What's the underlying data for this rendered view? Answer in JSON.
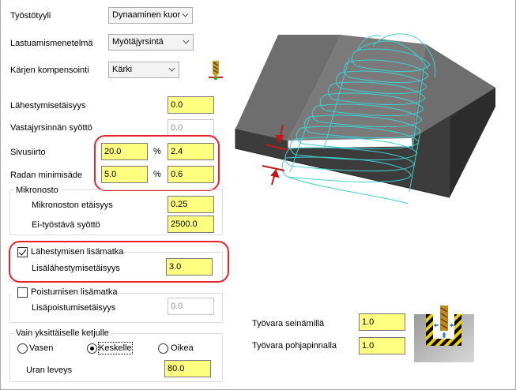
{
  "style_label": "Työstötyyli",
  "style_value": "Dynaaminen kuor",
  "method_label": "Lastuamismenetelmä",
  "method_value": "Myötäjyrsintä",
  "comp_label": "Kärjen kompensointi",
  "comp_value": "Kärki",
  "approach_dist_label": "Lähestymisetäisyys",
  "approach_dist_value": "0.0",
  "counter_feed_label": "Vastajyrsinnän syöttö",
  "counter_feed_value": "0.0",
  "stepover_label": "Sivusiirto",
  "stepover_pct": "20.0",
  "stepover_val": "2.4",
  "min_radius_label": "Radan minimisäde",
  "min_radius_pct": "5.0",
  "min_radius_val": "0.6",
  "percent_sign": "%",
  "micro": {
    "title": "Mikronosto",
    "dist_label": "Mikronoston etäisyys",
    "dist_value": "0.25",
    "feed_label": "Ei-työstävä syöttö",
    "feed_value": "2500.0"
  },
  "approach_extra": {
    "title": "Lähestymisen lisämatka",
    "checked": true,
    "dist_label": "Lisälähestymisetäisyys",
    "dist_value": "3.0"
  },
  "exit_extra": {
    "title": "Poistumisen lisämatka",
    "checked": false,
    "dist_label": "Lisäpoistumisetäisyys",
    "dist_value": "0.0"
  },
  "single_chain": {
    "title": "Vain yksittäiselle ketjulle",
    "options": [
      "Vasen",
      "Keskelle",
      "Oikea"
    ],
    "selected": "Keskelle",
    "width_label": "Uran leveys",
    "width_value": "80.0"
  },
  "wall_stock_label": "Työvara seinämillä",
  "wall_stock_value": "1.0",
  "floor_stock_label": "Työvara pohjapinnalla",
  "floor_stock_value": "1.0",
  "colors": {
    "input_bg": "#ffff80",
    "highlight_red": "#e8232e",
    "toolpath_cyan": "#3ecfd3",
    "block_gray": "#505050"
  },
  "icons": [
    "tool-tip-icon",
    "stock-allowance-icon"
  ]
}
